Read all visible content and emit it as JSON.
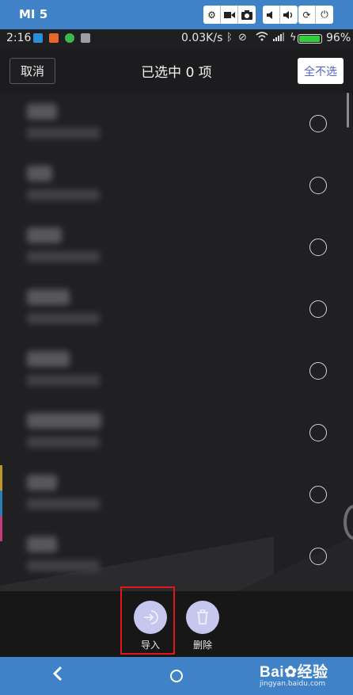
{
  "emulator": {
    "device_name": "MI 5",
    "buttons": [
      "gear-icon",
      "video-icon",
      "camera-icon",
      "volume-down-icon",
      "volume-up-icon",
      "rotate-icon",
      "power-icon"
    ]
  },
  "status_bar": {
    "time": "2:16",
    "net_speed": "0.03K/s",
    "battery_percent": "96%",
    "battery_level": 0.96,
    "icons": [
      "bluetooth-icon",
      "alarm-off-icon",
      "wifi-icon",
      "signal-icon",
      "charging-icon"
    ]
  },
  "header": {
    "cancel_label": "取消",
    "title": "已选中 0 项",
    "select_all_label": "全不选"
  },
  "list": {
    "items": [
      {
        "name": "████",
        "detail": "██████████",
        "selected": false
      },
      {
        "name": "███",
        "detail": "██████████",
        "selected": false
      },
      {
        "name": "████",
        "detail": "██████████",
        "selected": false
      },
      {
        "name": "██████",
        "detail": "██████████",
        "selected": false
      },
      {
        "name": "█████",
        "detail": "██████████",
        "selected": false
      },
      {
        "name": "████████",
        "detail": "██████████",
        "selected": false
      },
      {
        "name": "████",
        "detail": "██████████",
        "selected": false
      },
      {
        "name": "████",
        "detail": "██████████",
        "selected": false
      }
    ]
  },
  "actions": {
    "import_label": "导入",
    "delete_label": "删除"
  },
  "nav_bar": {
    "icons": [
      "back-icon",
      "home-icon"
    ]
  },
  "watermark": {
    "brand": "Bai",
    "brand_suffix": "经验",
    "url": "jingyan.baidu.com"
  },
  "colors": {
    "highlight": "#e01717",
    "action_circle": "#c7c6ee",
    "select_all_text": "#5566c4",
    "bars": "#3f82c8"
  }
}
